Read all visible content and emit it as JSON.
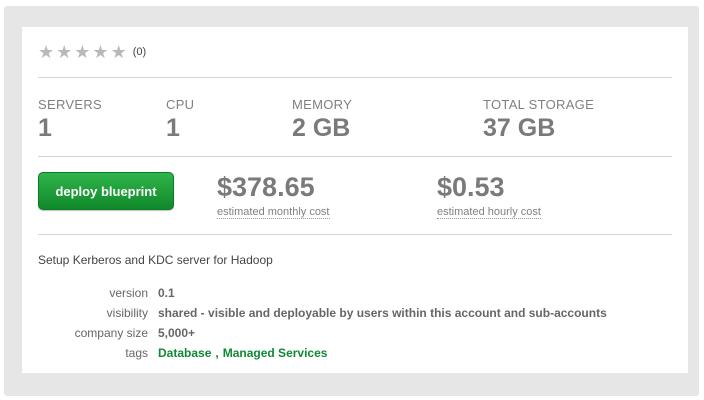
{
  "rating": {
    "stars": 5,
    "filled": 0,
    "count_text": "(0)"
  },
  "stats": [
    {
      "label": "SERVERS",
      "value": "1"
    },
    {
      "label": "CPU",
      "value": "1"
    },
    {
      "label": "MEMORY",
      "value": "2 GB"
    },
    {
      "label": "TOTAL STORAGE",
      "value": "37 GB"
    }
  ],
  "deploy": {
    "label": "deploy blueprint"
  },
  "costs": [
    {
      "value": "$378.65",
      "label": "estimated monthly cost"
    },
    {
      "value": "$0.53",
      "label": "estimated hourly cost"
    }
  ],
  "description": "Setup Kerberos and KDC server for Hadoop",
  "meta": {
    "version": {
      "key": "version",
      "value": "0.1"
    },
    "visibility": {
      "key": "visibility",
      "value": "shared - visible and deployable by users within this account and sub-accounts"
    },
    "company_size": {
      "key": "company size",
      "value": "5,000+"
    },
    "tags": {
      "key": "tags",
      "items": [
        "Database",
        "Managed Services"
      ],
      "separator": ","
    }
  },
  "colors": {
    "accent_green": "#10892a",
    "tag_green": "#0f8a34",
    "value_gray": "#7a7a7a"
  }
}
